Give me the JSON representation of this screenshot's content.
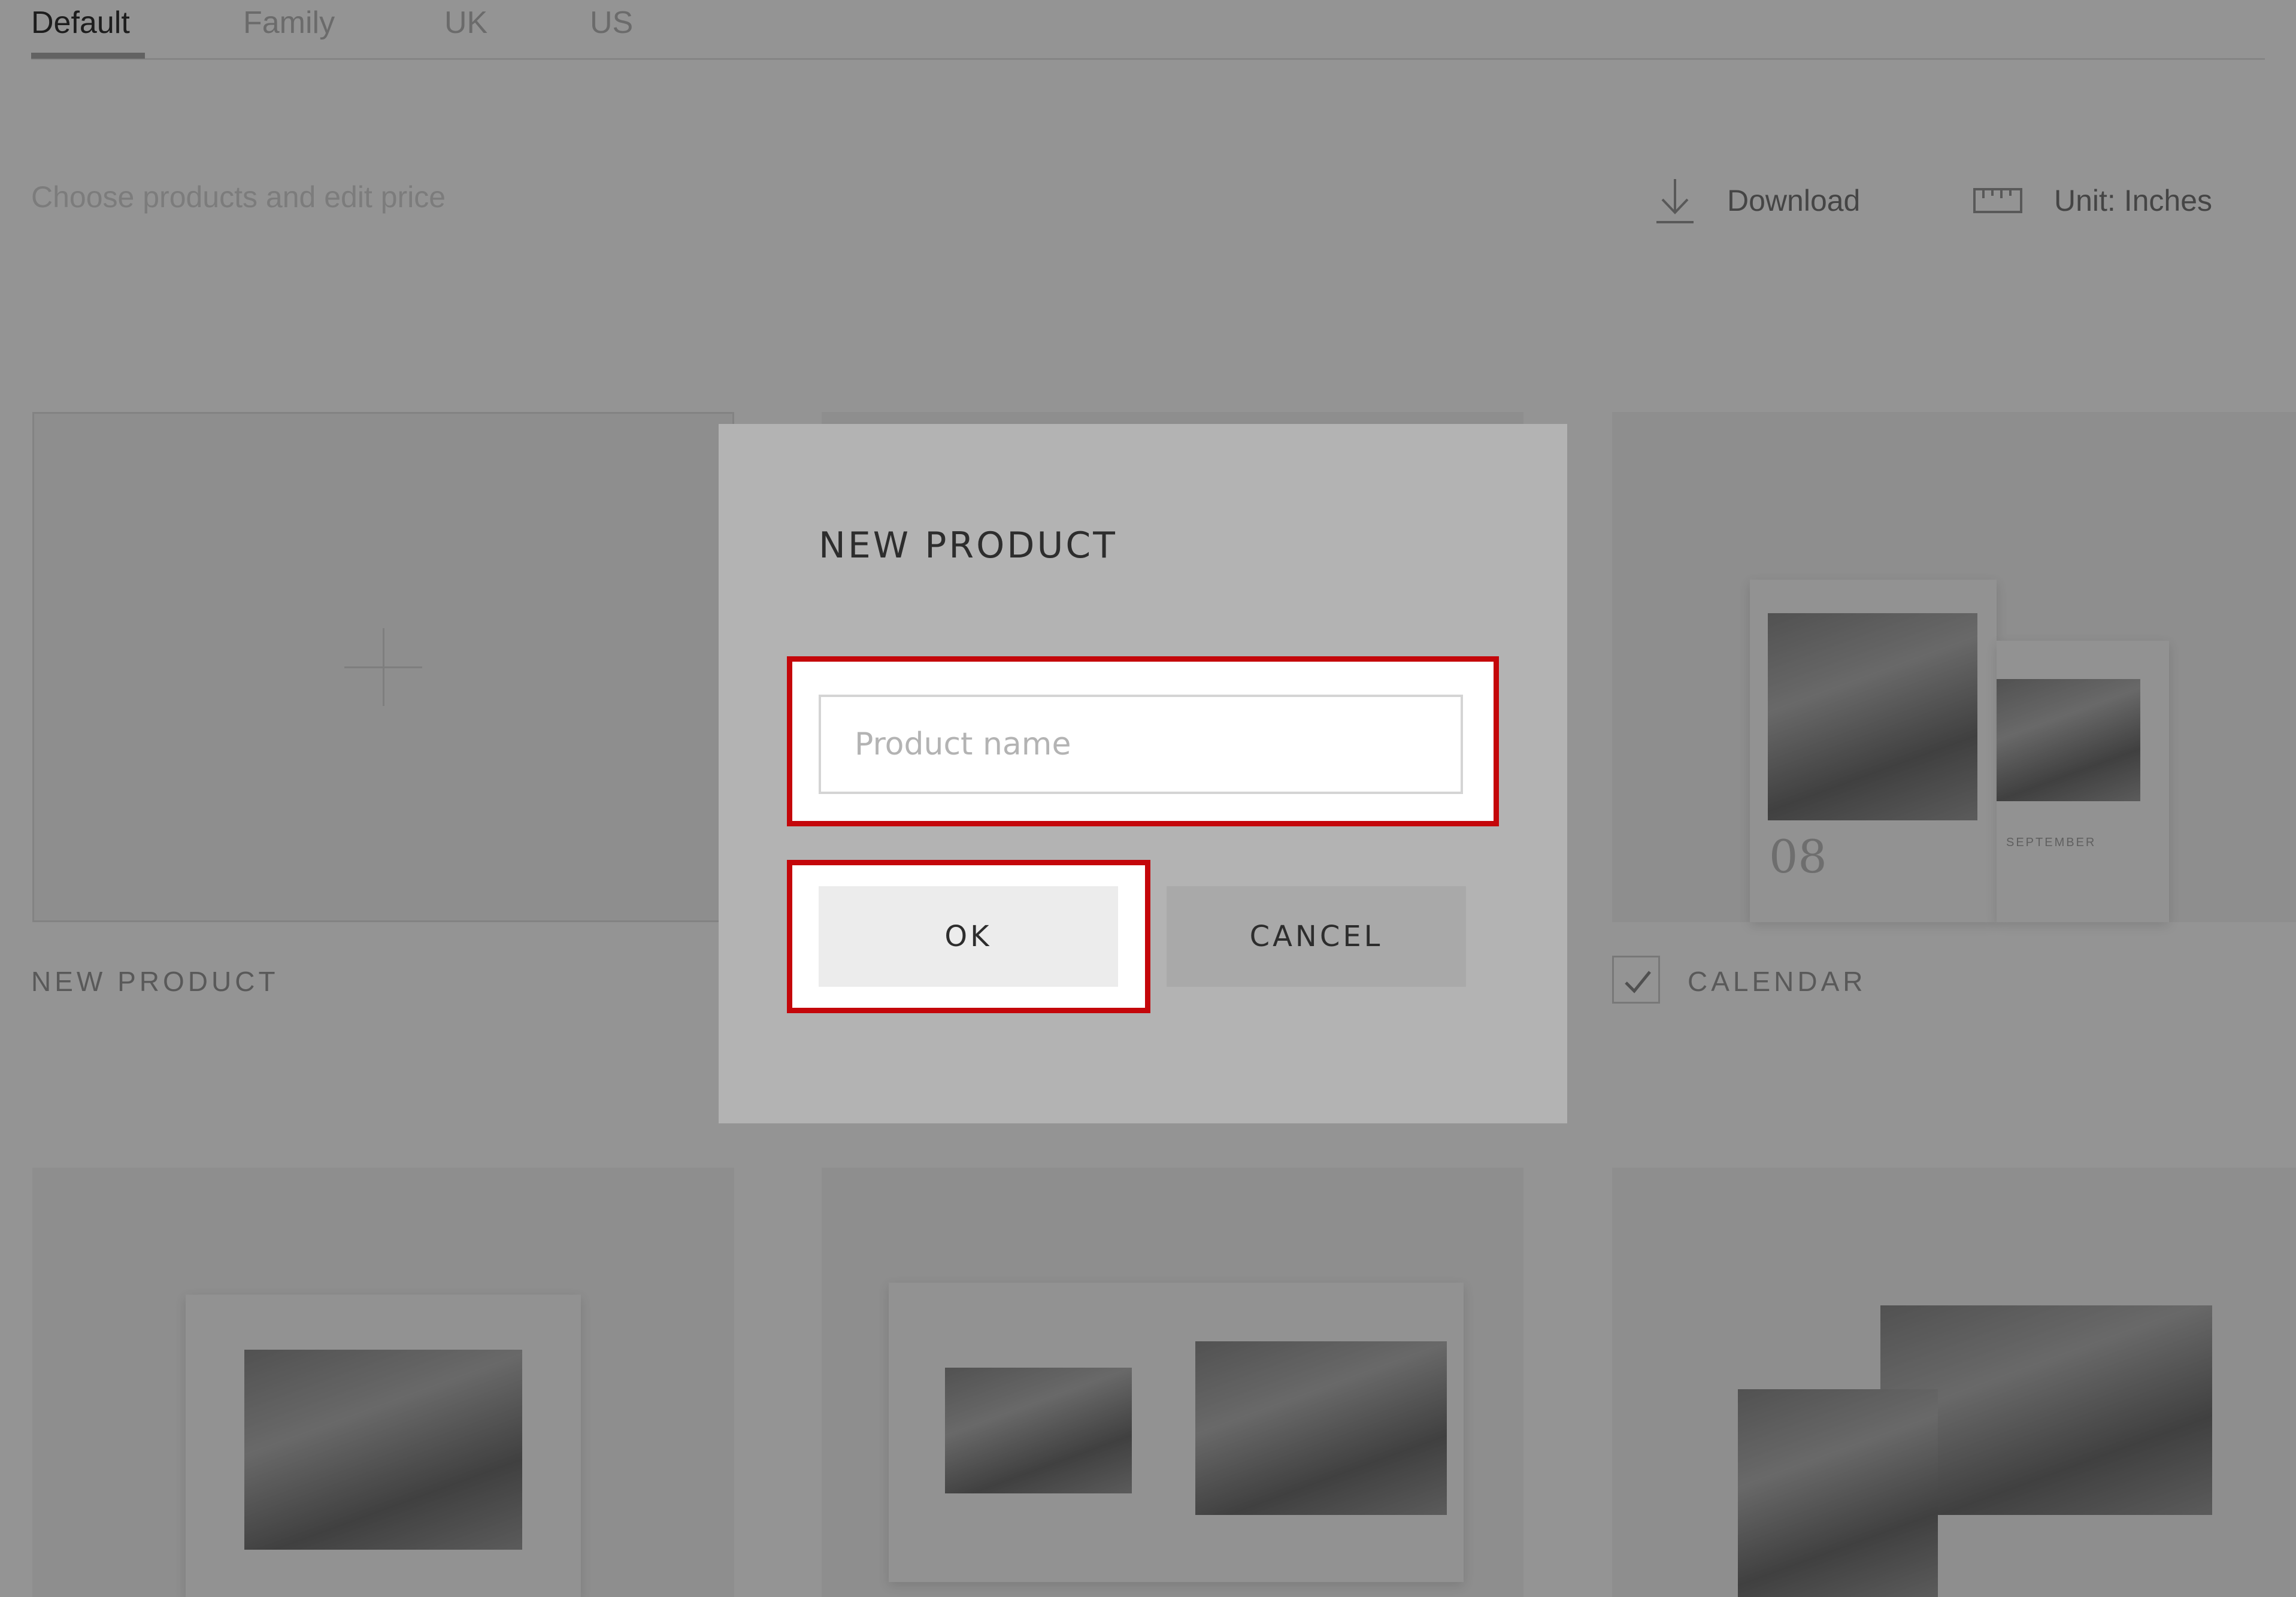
{
  "tabs": [
    "Default",
    "Family",
    "UK",
    "US"
  ],
  "subtitle": "Choose products and edit price",
  "toolbar": {
    "download_label": "Download",
    "unit_label": "Unit: Inches"
  },
  "cards": {
    "new_product_label": "NEW PRODUCT",
    "calendar_label": "CALENDAR",
    "calendar_date": "08",
    "calendar_month": "SEPTEMBER"
  },
  "dialog": {
    "title": "NEW PRODUCT",
    "input_placeholder": "Product name",
    "input_value": "",
    "ok_label": "OK",
    "cancel_label": "CANCEL"
  },
  "colors": {
    "highlight": "#c4060a",
    "overlay": "rgba(0,0,0,0.42)",
    "dialog_bg": "#b3b3b3"
  }
}
